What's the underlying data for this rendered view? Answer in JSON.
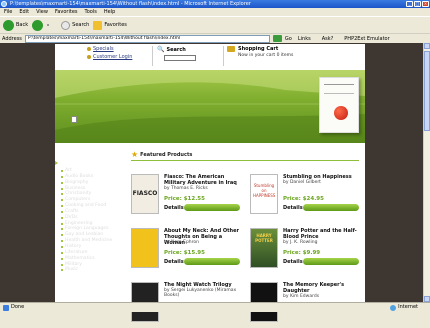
{
  "window": {
    "title": "P:\\templates\\maxmarti-154\\maxmarti-154\\Without flash\\index.html - Microsoft Internet Explorer"
  },
  "menu": [
    "File",
    "Edit",
    "View",
    "Favorites",
    "Tools",
    "Help"
  ],
  "toolbar": {
    "back": "Back",
    "search": "Search",
    "favorites": "Favorites"
  },
  "addressbar": {
    "label": "Address",
    "url": "P:\\templates\\maxmarti-154\\maxmarti-154\\Without flash\\index.html",
    "go": "Go",
    "links": "Links",
    "ext1": "Ask?",
    "ext2": "PHP2Ext Emulator"
  },
  "header": {
    "specials": "Specials",
    "customer_login": "Customer Login",
    "search_label": "Search",
    "cart_title": "Shopping Cart",
    "cart_sub": "Now in your cart 0 items"
  },
  "sidebar": {
    "title": "Store Categories",
    "items": [
      "Art",
      "Audio Books",
      "Biography",
      "Business",
      "Christianity",
      "Computers",
      "Cooking and Food",
      "Crafts",
      "DVDs",
      "Engineering",
      "Foreign Languages",
      "Gay and Lesbian",
      "Health and Medicine",
      "History",
      "Literature",
      "Mathematics",
      "Military",
      "Music"
    ]
  },
  "featured": {
    "title": "Featured Products",
    "details_label": "Details",
    "products": [
      {
        "title": "Fiasco: The American Military Adventure in Iraq",
        "author": "by Thomas E. Ricks",
        "price": "Price: $12.55",
        "cover": "FIASCO",
        "cover_color": "#f2ede2"
      },
      {
        "title": "Stumbling on Happiness",
        "author": "by Daniel Gilbert",
        "price": "Price: $24.95",
        "cover": "Stumbling on HAPPINESS",
        "cover_color": "#ffffff"
      },
      {
        "title": "About My Neck: And Other Thoughts on Being a Woman",
        "author": "by Nora Ephron",
        "price": "Price: $15.95",
        "cover": "",
        "cover_color": "#f2c21c"
      },
      {
        "title": "Harry Potter and the Half-Blood Prince",
        "author": "by J. K. Rowling",
        "price": "Price: $9.99",
        "cover": "HARRY POTTER",
        "cover_color": "#3f6b35"
      },
      {
        "title": "The Night Watch Trilogy",
        "author": "by Sergei Lukyanenko (Miramax Books)",
        "price": "",
        "cover": "",
        "cover_color": "#222222"
      },
      {
        "title": "The Memory Keeper's Daughter",
        "author": "by Kim Edwards",
        "price": "",
        "cover": "",
        "cover_color": "#111111"
      }
    ]
  },
  "status": {
    "left": "Done",
    "zone": "Internet"
  },
  "colors": {
    "accent": "#6aa51e",
    "dark_bg": "#3d3631",
    "xp_blue": "#1c55c8"
  }
}
